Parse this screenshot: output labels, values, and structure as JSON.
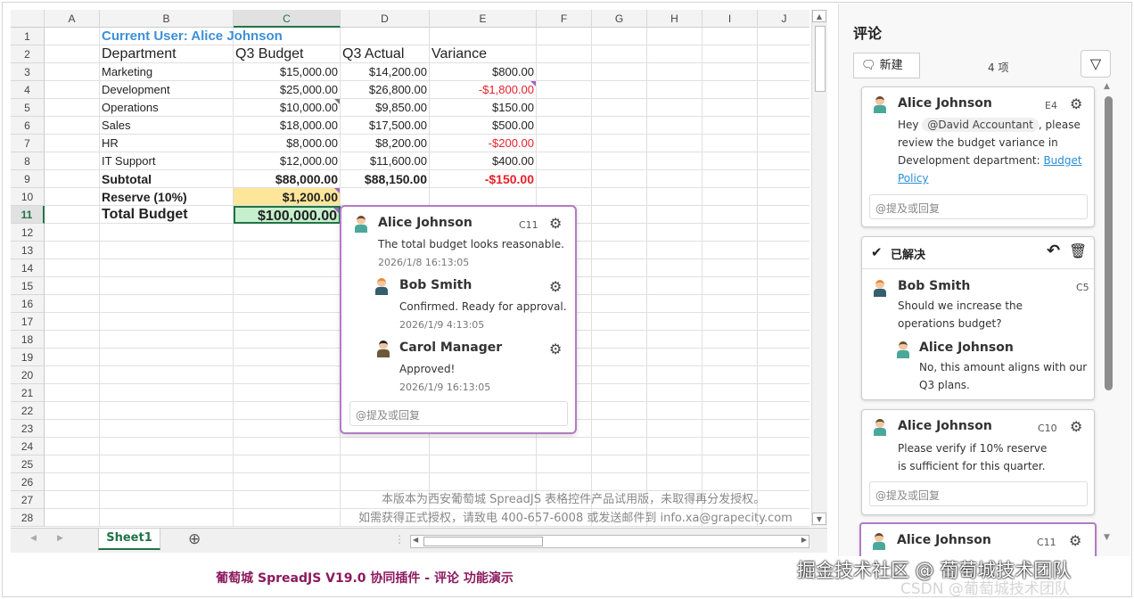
{
  "sheet": {
    "columns": [
      "A",
      "B",
      "C",
      "D",
      "E",
      "F",
      "G",
      "H",
      "I",
      "J"
    ],
    "selected_column": "C",
    "selected_row": 11,
    "row_count": 28,
    "rows": [
      {
        "B": "Current User: Alice Johnson"
      },
      {
        "B": "Department",
        "C": "Q3 Budget",
        "D": "Q3 Actual",
        "E": "Variance"
      },
      {
        "B": "Marketing",
        "C": "$15,000.00",
        "D": "$14,200.00",
        "E": "$800.00"
      },
      {
        "B": "Development",
        "C": "$25,000.00",
        "D": "$26,800.00",
        "E": "-$1,800.00"
      },
      {
        "B": "Operations",
        "C": "$10,000.00",
        "D": "$9,850.00",
        "E": "$150.00"
      },
      {
        "B": "Sales",
        "C": "$18,000.00",
        "D": "$17,500.00",
        "E": "$500.00"
      },
      {
        "B": "HR",
        "C": "$8,000.00",
        "D": "$8,200.00",
        "E": "-$200.00"
      },
      {
        "B": "IT Support",
        "C": "$12,000.00",
        "D": "$11,600.00",
        "E": "$400.00"
      },
      {
        "B": "Subtotal",
        "C": "$88,000.00",
        "D": "$88,150.00",
        "E": "-$150.00"
      },
      {
        "B": "Reserve (10%)",
        "C": "$1,200.00"
      },
      {
        "B": "Total Budget",
        "C": "$100,000.00"
      }
    ],
    "comment_cells": [
      "E4",
      "C5",
      "C10",
      "C11"
    ],
    "watermark_line1": "本版本为西安葡萄城 SpreadJS 表格控件产品试用版，未取得再分发授权。",
    "watermark_line2": "如需获得正式授权，请致电 400-657-6008 或发送邮件到  info.xa@grapecity.com",
    "tab": "Sheet1",
    "add_sheet": "⊕"
  },
  "popup": {
    "cell": "C11",
    "author": "Alice Johnson",
    "text": "The total budget looks reasonable.",
    "time": "2026/1/8 16:13:05",
    "replies": [
      {
        "author": "Bob Smith",
        "text": "Confirmed. Ready for approval.",
        "time": "2026/1/9 4:13:05"
      },
      {
        "author": "Carol Manager",
        "text": "Approved!",
        "time": "2026/1/9 16:13:05"
      }
    ],
    "reply_placeholder": "@提及或回复"
  },
  "panel": {
    "title": "评论",
    "new_label": "新建",
    "count": "4 项",
    "cards": [
      {
        "author": "Alice Johnson",
        "cell": "E4",
        "text_pre": "Hey ",
        "mention": "@David Accountant",
        "text_mid": ", please review the budget variance in Development department: ",
        "link": "Budget Policy",
        "reply_placeholder": "@提及或回复"
      },
      {
        "resolved_label": "已解决",
        "author": "Bob Smith",
        "cell": "C5",
        "text": "Should we increase the operations budget?",
        "reply_author": "Alice Johnson",
        "reply_text": "No, this amount aligns with our Q3 plans."
      },
      {
        "author": "Alice Johnson",
        "cell": "C10",
        "text": "Please verify if 10% reserve is sufficient for this quarter.",
        "reply_placeholder": "@提及或回复"
      },
      {
        "author": "Alice Johnson",
        "cell": "C11"
      }
    ]
  },
  "footer": {
    "title": "葡萄城 SpreadJS V19.0 协同插件 - 评论 功能演示",
    "watermark": "掘金技术社区 @ 葡萄城技术团队",
    "watermark2": "CSDN @葡萄城技术团队",
    "title_color": "#8b1a5e"
  }
}
